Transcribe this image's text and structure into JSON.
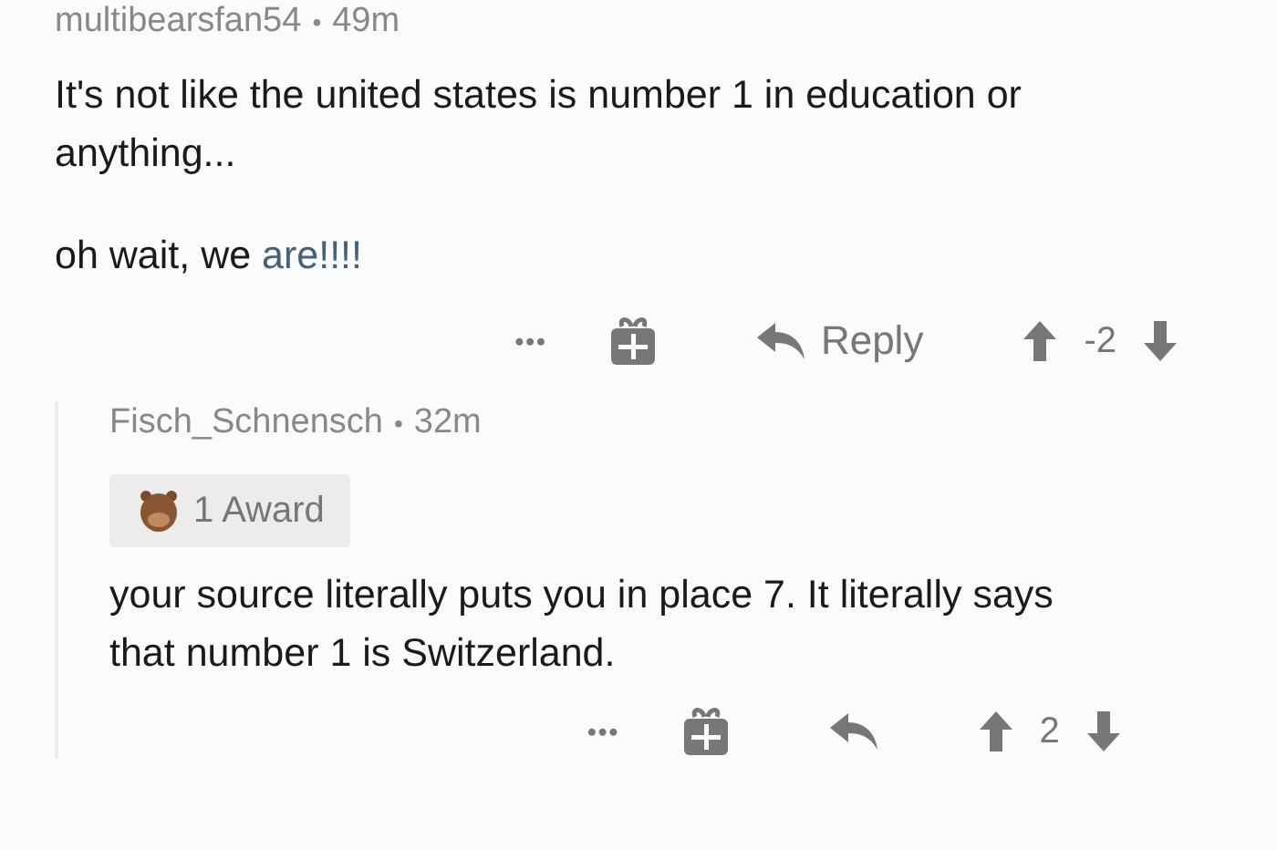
{
  "comments": [
    {
      "author": "multibearsfan54",
      "age": "49m",
      "paragraphs": [
        {
          "parts": [
            {
              "kind": "text",
              "text": "It's not like the united states is number 1 in education or anything..."
            }
          ]
        },
        {
          "parts": [
            {
              "kind": "text",
              "text": "oh wait, we "
            },
            {
              "kind": "link",
              "text": "are!!!!"
            }
          ]
        }
      ],
      "more": "•••",
      "reply": "Reply",
      "score": "-2"
    },
    {
      "author": "Fisch_Schnensch",
      "age": "32m",
      "award": "1 Award",
      "paragraphs": [
        {
          "parts": [
            {
              "kind": "text",
              "text": "your source literally puts you in place 7. It literally says that number 1 is Switzerland."
            }
          ]
        }
      ],
      "more": "•••",
      "score": "2"
    }
  ],
  "separator": "•"
}
